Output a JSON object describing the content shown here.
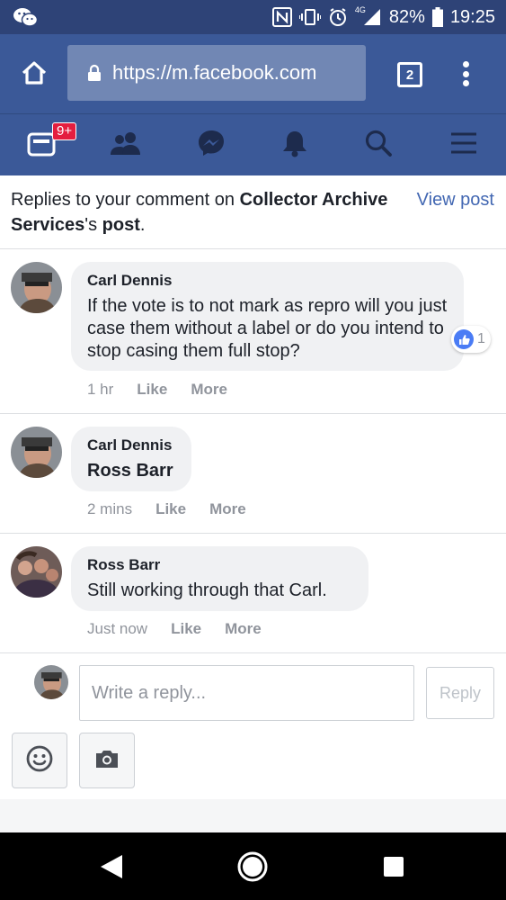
{
  "status_bar": {
    "network": "4G",
    "battery": "82%",
    "time": "19:25"
  },
  "browser": {
    "url": "https://m.facebook.com",
    "tab_count": "2"
  },
  "fb_nav": {
    "notification_badge": "9+"
  },
  "header": {
    "prefix": "Replies to your comment on ",
    "page_name": "Collector Archive Services",
    "suffix_mid": "'s ",
    "post_word": "post",
    "period": ".",
    "view_post": "View post"
  },
  "comments": [
    {
      "author": "Carl Dennis",
      "text": "If the vote is to not mark as repro will you just case them without a label or do you intend to stop casing them full stop?",
      "time": "1 hr",
      "like": "Like",
      "more": "More",
      "reaction_count": "1"
    },
    {
      "author": "Carl Dennis",
      "text": "Ross Barr",
      "time": "2 mins",
      "like": "Like",
      "more": "More"
    },
    {
      "author": "Ross Barr",
      "text": "Still working through that Carl.",
      "time": "Just now",
      "like": "Like",
      "more": "More"
    }
  ],
  "composer": {
    "placeholder": "Write a reply...",
    "reply_label": "Reply"
  },
  "colors": {
    "fb_blue": "#3b5998",
    "status_bar": "#2e4377",
    "link_blue": "#4267b2",
    "badge_red": "#e41e3f"
  }
}
